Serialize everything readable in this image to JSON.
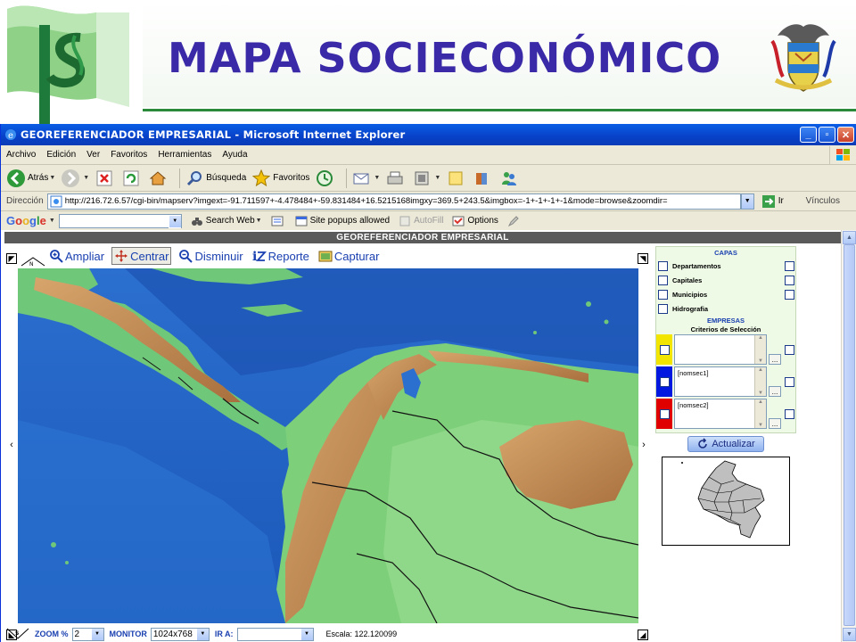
{
  "slide": {
    "title": "MAPA SOCIECONÓMICO"
  },
  "browser": {
    "window_title": "GEOREFERENCIADOR EMPRESARIAL - Microsoft Internet Explorer",
    "menu": [
      "Archivo",
      "Edición",
      "Ver",
      "Favoritos",
      "Herramientas",
      "Ayuda"
    ],
    "toolbar": {
      "back": "Atrás",
      "search": "Búsqueda",
      "favorites": "Favoritos"
    },
    "address": {
      "label": "Dirección",
      "url": "http://216.72.6.57/cgi-bin/mapserv?imgext=-91.711597+-4.478484+-59.831484+16.5215168imgxy=369.5+243.5&imgbox=-1+-1+-1+-1&mode=browse&zoomdir=",
      "go": "Ir",
      "links": "Vínculos"
    },
    "google_bar": {
      "logo": "Google",
      "search_web": "Search Web",
      "popups": "Site popups allowed",
      "autofill": "AutoFill",
      "options": "Options"
    }
  },
  "app": {
    "header": "GEOREFERENCIADOR EMPRESARIAL",
    "tools": [
      {
        "label": "Ampliar",
        "icon": "zoom-in-icon"
      },
      {
        "label": "Centrar",
        "icon": "pan-icon"
      },
      {
        "label": "Disminuir",
        "icon": "zoom-out-icon"
      },
      {
        "label": "Reporte",
        "icon": "report-icon"
      },
      {
        "label": "Capturar",
        "icon": "capture-icon"
      }
    ],
    "active_tool": "Centrar",
    "bottom": {
      "zoom_label": "ZOOM %",
      "zoom_value": "2",
      "monitor_label": "MONITOR",
      "monitor_value": "1024x768",
      "goto_label": "IR A:",
      "goto_value": "",
      "scale": "Escala: 122.120099"
    },
    "panel": {
      "layers_heading": "CAPAS",
      "layers": [
        "Departamentos",
        "Capitales",
        "Municipios",
        "Hidrografia"
      ],
      "companies_heading": "EMPRESAS",
      "criteria_heading": "Criterios de Selección",
      "criteria": [
        {
          "color": "#f2e600",
          "value": ""
        },
        {
          "color": "#0018e0",
          "value": "[nomsec1]"
        },
        {
          "color": "#e00000",
          "value": "[nomsec2]"
        }
      ],
      "refresh": "Actualizar"
    },
    "map_colors": {
      "ocean": "#1f5cbc",
      "lowland": "#7ecf7a",
      "highland": "#c8955e"
    }
  }
}
